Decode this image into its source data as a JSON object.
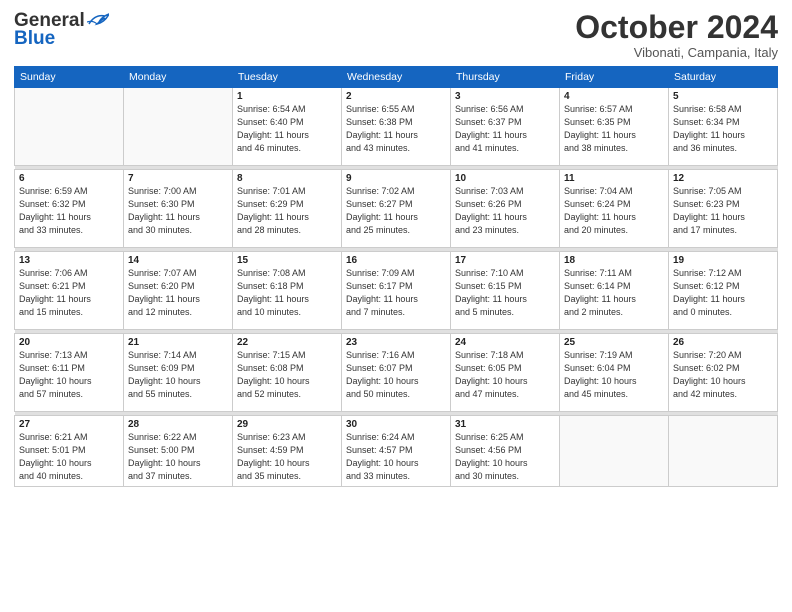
{
  "header": {
    "logo_general": "General",
    "logo_blue": "Blue",
    "month_title": "October 2024",
    "location": "Vibonati, Campania, Italy"
  },
  "days_of_week": [
    "Sunday",
    "Monday",
    "Tuesday",
    "Wednesday",
    "Thursday",
    "Friday",
    "Saturday"
  ],
  "weeks": [
    [
      {
        "day": "",
        "info": ""
      },
      {
        "day": "",
        "info": ""
      },
      {
        "day": "1",
        "info": "Sunrise: 6:54 AM\nSunset: 6:40 PM\nDaylight: 11 hours\nand 46 minutes."
      },
      {
        "day": "2",
        "info": "Sunrise: 6:55 AM\nSunset: 6:38 PM\nDaylight: 11 hours\nand 43 minutes."
      },
      {
        "day": "3",
        "info": "Sunrise: 6:56 AM\nSunset: 6:37 PM\nDaylight: 11 hours\nand 41 minutes."
      },
      {
        "day": "4",
        "info": "Sunrise: 6:57 AM\nSunset: 6:35 PM\nDaylight: 11 hours\nand 38 minutes."
      },
      {
        "day": "5",
        "info": "Sunrise: 6:58 AM\nSunset: 6:34 PM\nDaylight: 11 hours\nand 36 minutes."
      }
    ],
    [
      {
        "day": "6",
        "info": "Sunrise: 6:59 AM\nSunset: 6:32 PM\nDaylight: 11 hours\nand 33 minutes."
      },
      {
        "day": "7",
        "info": "Sunrise: 7:00 AM\nSunset: 6:30 PM\nDaylight: 11 hours\nand 30 minutes."
      },
      {
        "day": "8",
        "info": "Sunrise: 7:01 AM\nSunset: 6:29 PM\nDaylight: 11 hours\nand 28 minutes."
      },
      {
        "day": "9",
        "info": "Sunrise: 7:02 AM\nSunset: 6:27 PM\nDaylight: 11 hours\nand 25 minutes."
      },
      {
        "day": "10",
        "info": "Sunrise: 7:03 AM\nSunset: 6:26 PM\nDaylight: 11 hours\nand 23 minutes."
      },
      {
        "day": "11",
        "info": "Sunrise: 7:04 AM\nSunset: 6:24 PM\nDaylight: 11 hours\nand 20 minutes."
      },
      {
        "day": "12",
        "info": "Sunrise: 7:05 AM\nSunset: 6:23 PM\nDaylight: 11 hours\nand 17 minutes."
      }
    ],
    [
      {
        "day": "13",
        "info": "Sunrise: 7:06 AM\nSunset: 6:21 PM\nDaylight: 11 hours\nand 15 minutes."
      },
      {
        "day": "14",
        "info": "Sunrise: 7:07 AM\nSunset: 6:20 PM\nDaylight: 11 hours\nand 12 minutes."
      },
      {
        "day": "15",
        "info": "Sunrise: 7:08 AM\nSunset: 6:18 PM\nDaylight: 11 hours\nand 10 minutes."
      },
      {
        "day": "16",
        "info": "Sunrise: 7:09 AM\nSunset: 6:17 PM\nDaylight: 11 hours\nand 7 minutes."
      },
      {
        "day": "17",
        "info": "Sunrise: 7:10 AM\nSunset: 6:15 PM\nDaylight: 11 hours\nand 5 minutes."
      },
      {
        "day": "18",
        "info": "Sunrise: 7:11 AM\nSunset: 6:14 PM\nDaylight: 11 hours\nand 2 minutes."
      },
      {
        "day": "19",
        "info": "Sunrise: 7:12 AM\nSunset: 6:12 PM\nDaylight: 11 hours\nand 0 minutes."
      }
    ],
    [
      {
        "day": "20",
        "info": "Sunrise: 7:13 AM\nSunset: 6:11 PM\nDaylight: 10 hours\nand 57 minutes."
      },
      {
        "day": "21",
        "info": "Sunrise: 7:14 AM\nSunset: 6:09 PM\nDaylight: 10 hours\nand 55 minutes."
      },
      {
        "day": "22",
        "info": "Sunrise: 7:15 AM\nSunset: 6:08 PM\nDaylight: 10 hours\nand 52 minutes."
      },
      {
        "day": "23",
        "info": "Sunrise: 7:16 AM\nSunset: 6:07 PM\nDaylight: 10 hours\nand 50 minutes."
      },
      {
        "day": "24",
        "info": "Sunrise: 7:18 AM\nSunset: 6:05 PM\nDaylight: 10 hours\nand 47 minutes."
      },
      {
        "day": "25",
        "info": "Sunrise: 7:19 AM\nSunset: 6:04 PM\nDaylight: 10 hours\nand 45 minutes."
      },
      {
        "day": "26",
        "info": "Sunrise: 7:20 AM\nSunset: 6:02 PM\nDaylight: 10 hours\nand 42 minutes."
      }
    ],
    [
      {
        "day": "27",
        "info": "Sunrise: 6:21 AM\nSunset: 5:01 PM\nDaylight: 10 hours\nand 40 minutes."
      },
      {
        "day": "28",
        "info": "Sunrise: 6:22 AM\nSunset: 5:00 PM\nDaylight: 10 hours\nand 37 minutes."
      },
      {
        "day": "29",
        "info": "Sunrise: 6:23 AM\nSunset: 4:59 PM\nDaylight: 10 hours\nand 35 minutes."
      },
      {
        "day": "30",
        "info": "Sunrise: 6:24 AM\nSunset: 4:57 PM\nDaylight: 10 hours\nand 33 minutes."
      },
      {
        "day": "31",
        "info": "Sunrise: 6:25 AM\nSunset: 4:56 PM\nDaylight: 10 hours\nand 30 minutes."
      },
      {
        "day": "",
        "info": ""
      },
      {
        "day": "",
        "info": ""
      }
    ]
  ]
}
